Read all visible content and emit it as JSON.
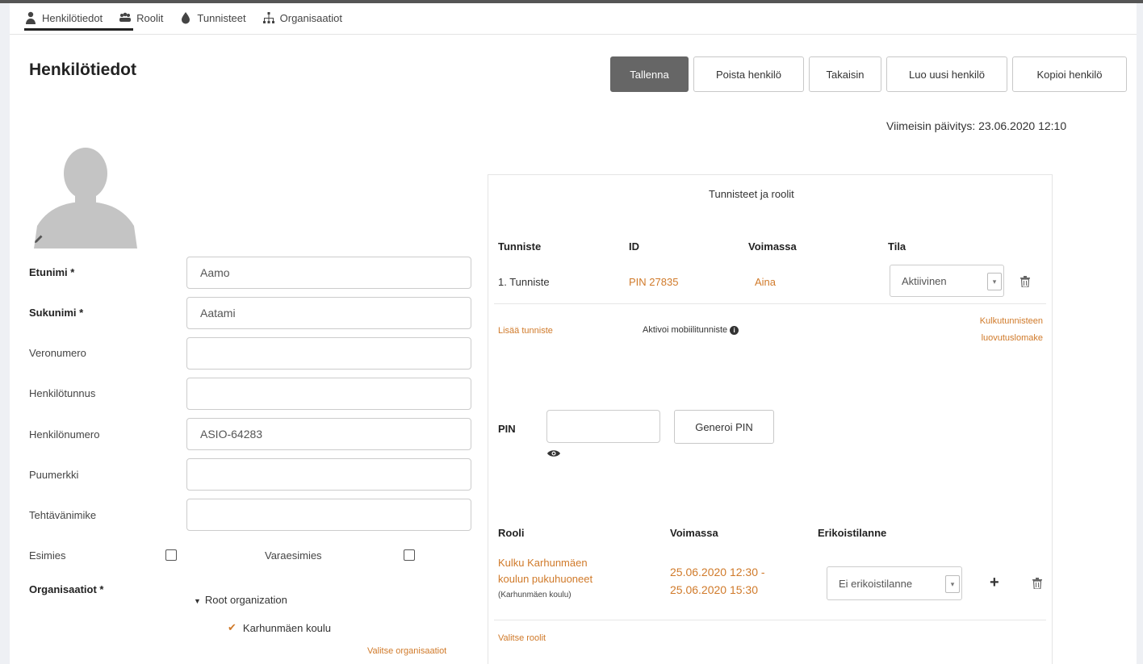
{
  "nav": {
    "items": [
      {
        "label": "Henkilötiedot",
        "icon": "person-icon"
      },
      {
        "label": "Roolit",
        "icon": "users-icon"
      },
      {
        "label": "Tunnisteet",
        "icon": "tag-icon"
      },
      {
        "label": "Organisaatiot",
        "icon": "org-chart-icon"
      }
    ]
  },
  "page": {
    "title": "Henkilötiedot",
    "last_update": "Viimeisin päivitys: 23.06.2020 12:10"
  },
  "toolbar": {
    "save": "Tallenna",
    "delete": "Poista henkilö",
    "back": "Takaisin",
    "new": "Luo uusi henkilö",
    "copy": "Kopioi henkilö"
  },
  "form": {
    "first_name_label": "Etunimi *",
    "first_name_value": "Aamo",
    "last_name_label": "Sukunimi *",
    "last_name_value": "Aatami",
    "tax_label": "Veronumero",
    "tax_value": "",
    "ssn_label": "Henkilötunnus",
    "ssn_value": "",
    "person_number_label": "Henkilönumero",
    "person_number_value": "ASIO-64283",
    "initials_label": "Puumerkki",
    "initials_value": "",
    "job_title_label": "Tehtävänimike",
    "job_title_value": "",
    "supervisor_label": "Esimies",
    "deputy_label": "Varaesimies",
    "org_label": "Organisaatiot *",
    "tree_root": "Root organization",
    "tree_child": "Karhunmäen koulu",
    "select_orgs": "Valitse organisaatiot"
  },
  "panel": {
    "title": "Tunnisteet ja roolit",
    "id_headers": {
      "tunniste": "Tunniste",
      "id": "ID",
      "voimassa": "Voimassa",
      "tila": "Tila"
    },
    "id_row": {
      "tunniste": "1. Tunniste",
      "id": "PIN 27835",
      "voimassa": "Aina",
      "tila": "Aktiivinen"
    },
    "add_id": "Lisää tunniste",
    "activate_mobile": "Aktivoi mobiilitunniste",
    "handover_line1": "Kulkutunnisteen",
    "handover_line2": "luovutuslomake",
    "pin_label": "PIN",
    "generate_pin": "Generoi PIN",
    "role_headers": {
      "rooli": "Rooli",
      "voimassa": "Voimassa",
      "erikois": "Erikoistilanne"
    },
    "role_row": {
      "name_line1": "Kulku Karhunmäen",
      "name_line2": "koulun pukuhuoneet",
      "org": "(Karhunmäen koulu)",
      "valid_line1": "25.06.2020 12:30 -",
      "valid_line2": "25.06.2020 15:30",
      "special": "Ei erikoistilanne"
    },
    "select_roles": "Valitse roolit"
  },
  "colors": {
    "accent": "#d07a2a",
    "primary_button": "#666666"
  }
}
